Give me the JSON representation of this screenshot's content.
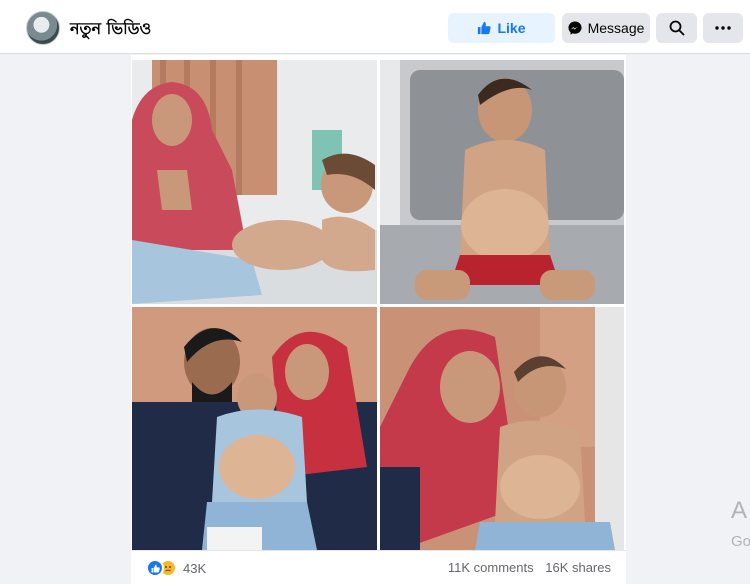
{
  "header": {
    "page_name": "নতুন ভিডিও",
    "like_label": "Like",
    "message_label": "Message"
  },
  "icons": {
    "avatar": "page-avatar",
    "like": "thumbs-up-icon",
    "message": "messenger-icon",
    "search": "search-icon",
    "more": "more-icon"
  },
  "post": {
    "reaction_count": "43K",
    "comments": "11K comments",
    "shares": "16K shares"
  },
  "side": {
    "text_a": "A",
    "text_go": "Go"
  },
  "colors": {
    "brand": "#1877f2",
    "background": "#f0f2f5",
    "reaction_like": "#1877f2",
    "reaction_sad": "#f7b928"
  }
}
